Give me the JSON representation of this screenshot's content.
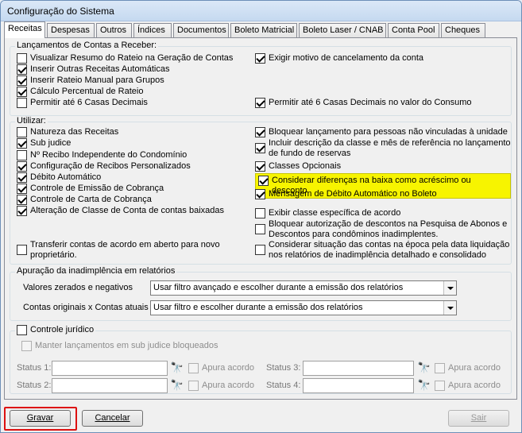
{
  "window": {
    "title": "Configuração do Sistema"
  },
  "tabs": [
    "Receitas",
    "Despesas",
    "Outros",
    "Índices",
    "Documentos",
    "Boleto Matricial",
    "Boleto Laser / CNAB",
    "Conta Pool",
    "Cheques"
  ],
  "lancamentos": {
    "legend": "Lançamentos de Contas a Receber:",
    "left": [
      {
        "label": "Visualizar Resumo do Rateio na Geração de Contas",
        "checked": false
      },
      {
        "label": "Inserir Outras Receitas Automáticas",
        "checked": true
      },
      {
        "label": "Inserir Rateio Manual para Grupos",
        "checked": true
      },
      {
        "label": "Cálculo Percentual de Rateio",
        "checked": true
      },
      {
        "label": "Permitir até 6 Casas Decimais",
        "checked": false
      }
    ],
    "right": [
      {
        "label": "Exigir motivo de cancelamento da conta",
        "checked": true
      },
      {
        "label": "Permitir até 6 Casas Decimais no valor do Consumo",
        "checked": true
      }
    ]
  },
  "utilizar": {
    "legend": "Utilizar:",
    "left": [
      {
        "label": "Natureza das Receitas",
        "checked": false
      },
      {
        "label": "Sub judice",
        "checked": true
      },
      {
        "label": "Nº Recibo Independente do Condomínio",
        "checked": false
      },
      {
        "label": "Configuração de Recibos Personalizados",
        "checked": true
      },
      {
        "label": "Débito Automático",
        "checked": true
      },
      {
        "label": "Controle de Emissão de Cobrança",
        "checked": true
      },
      {
        "label": "Controle de Carta de Cobrança",
        "checked": true
      },
      {
        "label": "Alteração de Classe de Conta de contas baixadas",
        "checked": true
      }
    ],
    "transferir": {
      "label1": "Transferir contas de acordo em aberto para novo",
      "label2": "proprietário.",
      "checked": false
    },
    "right": [
      {
        "label1": "Bloquear lançamento para pessoas não vinculadas à unidade",
        "label2": "",
        "checked": true
      },
      {
        "label1": "Incluir descrição da classe e mês de referência no lançamento",
        "label2": "de fundo de reservas",
        "checked": true
      },
      {
        "label1": "Classes Opcionais",
        "label2": "",
        "checked": true
      },
      {
        "label1": "Considerar diferenças na baixa como acréscimo ou desconto",
        "label2": "",
        "checked": true
      },
      {
        "label1": "Mensagem de Débito Automático no Boleto",
        "label2": "",
        "checked": true
      },
      {
        "label1": "Exibir classe específica de acordo",
        "label2": "",
        "checked": false
      },
      {
        "label1": "Bloquear autorização de descontos na Pesquisa de Abonos e",
        "label2": "Descontos para condôminos inadimplentes.",
        "checked": false
      },
      {
        "label1": "Considerar situação das contas na época pela data liquidação",
        "label2": "nos relatórios de inadimplência detalhado e consolidado",
        "checked": false
      }
    ]
  },
  "apuracao": {
    "legend": "Apuração da inadimplência em relatórios",
    "valores_label": "Valores zerados e negativos",
    "valores_value": "Usar filtro avançado e escolher durante a emissão dos relatórios",
    "contas_label": "Contas originais x Contas atuais",
    "contas_value": "Usar filtro e escolher durante a emissão dos relatórios"
  },
  "juridico": {
    "legend": "Controle jurídico",
    "manter": "Manter lançamentos em sub judice bloqueados",
    "status": [
      "Status 1:",
      "Status 2:",
      "Status 3:",
      "Status 4:"
    ],
    "apura": "Apura acordo"
  },
  "buttons": {
    "gravar": "Gravar",
    "cancelar": "Cancelar",
    "sair": "Sair"
  }
}
